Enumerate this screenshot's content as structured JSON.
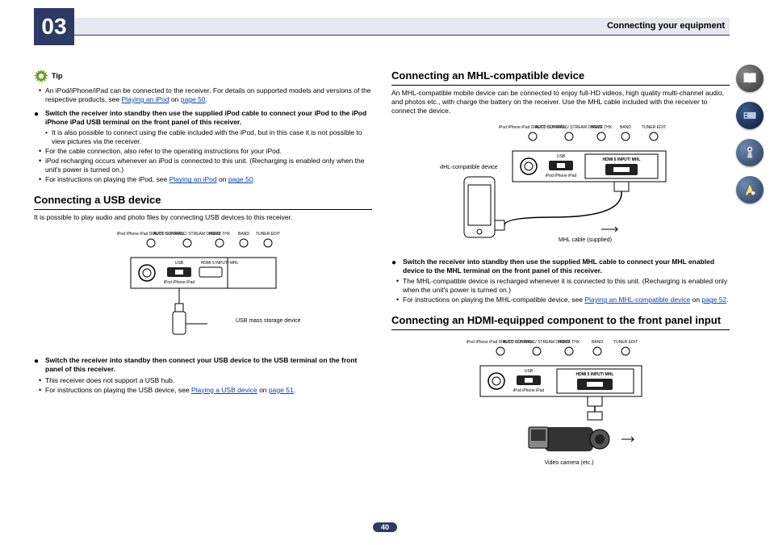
{
  "chapter": "03",
  "header_title": "Connecting your equipment",
  "page_number": "40",
  "tip": {
    "label": "Tip",
    "bullet1_pre": "An iPod/iPhone/iPad can be connected to the receiver. For details on supported models and versions of the respective products, see ",
    "bullet1_link": "Playing an iPod",
    "bullet1_on": " on ",
    "bullet1_page": "page 50",
    "bullet1_post": "."
  },
  "ipod_lead": "Switch the receiver into standby then use the supplied iPod cable to connect your iPod to the iPod iPhone iPad USB terminal on the front panel of this receiver.",
  "ipod_sub1": "It is also possible to connect using the cable included with the iPod, but in this case it is not possible to view pictures via the receiver.",
  "ipod_b2": "For the cable connection, also refer to the operating instructions for your iPod.",
  "ipod_b3": "iPod recharging occurs whenever an iPod is connected to this unit. (Recharging is enabled only when the unit's power is turned on.)",
  "ipod_b4_pre": "For instructions on playing the iPod, see ",
  "ipod_b4_link": "Playing an iPod",
  "ipod_b4_on": " on ",
  "ipod_b4_page": "page 50",
  "ipod_b4_post": ".",
  "usb": {
    "heading": "Connecting a USB device",
    "intro": "It is possible to play audio and photo files by connecting USB devices to this receiver.",
    "lead": "Switch the receiver into standby then connect your USB device to the USB terminal on the front panel of this receiver.",
    "b1": "This receiver does not support a USB hub.",
    "b2_pre": "For instructions on playing the USB device, see ",
    "b2_link": "Playing a USB device",
    "b2_on": " on ",
    "b2_page": "page 51",
    "b2_post": "."
  },
  "diagram_labels": {
    "panel_labels": [
      "iPod iPhone iPad DIRECT CONTROL",
      "AUTO SURR/ALC/ STREAM DIRECT",
      "HOME THX",
      "BAND",
      "TUNER EDIT"
    ],
    "usb_label": "USB",
    "ipod_label": "iPod iPhone iPad",
    "hdmi_label": "HDMI 5 INPUT/ MHL",
    "usb_device": "USB mass storage device",
    "mhl_device": "MHL-compatible device",
    "mhl_cable": "MHL cable (supplied)",
    "video_camera": "Video camera (etc.)"
  },
  "mhl": {
    "heading": "Connecting an MHL-compatible device",
    "intro": "An MHL-compatible mobile device can be connected to enjoy full-HD videos, high quality multi-channel audio, and photos etc., with charge the battery on the receiver. Use the MHL cable included with the receiver to connect the device.",
    "lead": "Switch the receiver into standby then use the supplied MHL cable to connect your MHL enabled device to the MHL terminal on the front panel of this receiver.",
    "b1": "The MHL-compatible device is recharged whenever it is connected to this unit. (Recharging is enabled only when the unit's power is turned on.)",
    "b2_pre": "For instructions on playing the MHL-compatible device, see ",
    "b2_link": "Playing an MHL-compatible device",
    "b2_on": " on ",
    "b2_page": "page 52",
    "b2_post": "."
  },
  "hdmi": {
    "heading": "Connecting an HDMI-equipped component to the front panel input"
  }
}
